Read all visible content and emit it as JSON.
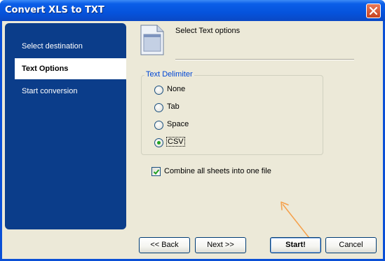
{
  "window": {
    "title": "Convert XLS to TXT"
  },
  "sidebar": {
    "items": [
      {
        "label": "Select destination"
      },
      {
        "label": "Text Options"
      },
      {
        "label": "Start conversion"
      }
    ]
  },
  "header": {
    "title": "Select Text options"
  },
  "delimiter": {
    "legend": "Text Delimiter",
    "options": [
      {
        "label": "None"
      },
      {
        "label": "Tab"
      },
      {
        "label": "Space"
      },
      {
        "label": "CSV"
      }
    ],
    "selected": "CSV"
  },
  "combine": {
    "label": "Combine all sheets into one file",
    "checked": true
  },
  "buttons": {
    "back": "<< Back",
    "next": "Next >>",
    "start": "Start!",
    "cancel": "Cancel"
  },
  "colors": {
    "sidebar": "#0b3d8a",
    "titlebar": "#0553dc",
    "arrow": "#f5a04a",
    "accent_text": "#0046d5"
  }
}
